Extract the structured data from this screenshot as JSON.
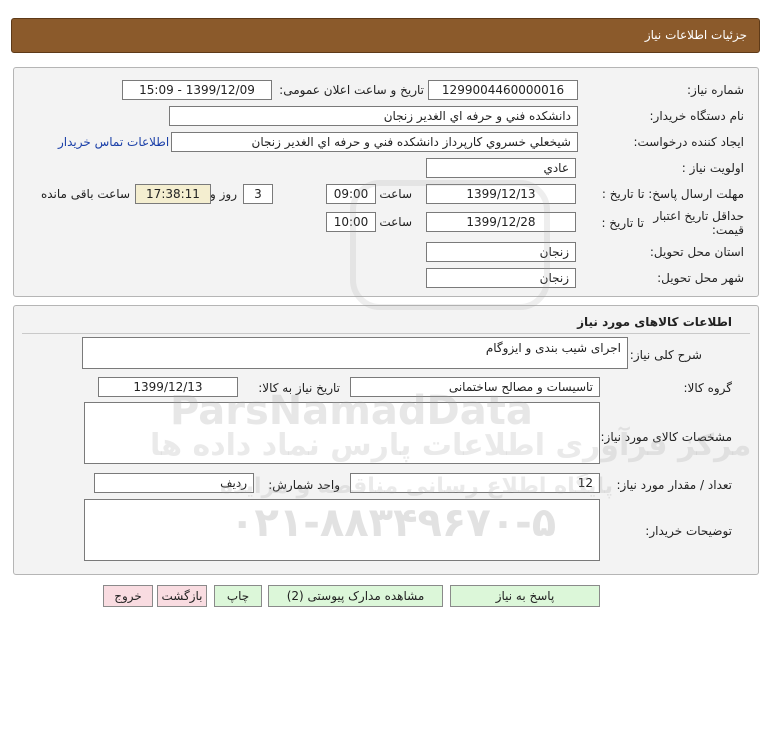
{
  "header": {
    "title": "جزئیات اطلاعات نیاز"
  },
  "info": {
    "need_number_label": "شماره نیاز:",
    "need_number": "1299004460000016",
    "announce_label": "تاریخ و ساعت اعلان عمومی:",
    "announce_value": "1399/12/09 - 15:09",
    "buyer_org_label": "نام دستگاه خریدار:",
    "buyer_org": "دانشکده فني و حرفه اي الغدير زنجان",
    "creator_label": "ایجاد کننده درخواست:",
    "creator": "شیخعلي خسروي کارپرداز دانشکده فني و حرفه اي الغدير زنجان",
    "contact_link": "اطلاعات تماس خریدار",
    "priority_label": "اولویت نیاز :",
    "priority": "عادي",
    "send_deadline_label": "مهلت ارسال پاسخ: تا تاریخ :",
    "send_deadline_date": "1399/12/13",
    "time_label": "ساعت",
    "send_deadline_time": "09:00",
    "days_value": "3",
    "days_label": "روز و",
    "remaining_time": "17:38:11",
    "remaining_label": "ساعت باقی مانده",
    "validity_label": "حداقل تاریخ اعتبار قیمت:",
    "validity_to_label": "تا تاریخ :",
    "validity_date": "1399/12/28",
    "validity_time_label": "ساعت",
    "validity_time": "10:00",
    "province_label": "استان محل تحویل:",
    "province": "زنجان",
    "city_label": "شهر محل تحویل:",
    "city": "زنجان"
  },
  "goods": {
    "section_title": "اطلاعات کالاهای مورد نیاز",
    "desc_label": "شرح کلی نیاز:",
    "desc": "اجرای شیب بندی و ایزوگام",
    "group_label": "گروه کالا:",
    "group": "تاسیسات و مصالح ساختمانی",
    "need_date_label": "تاریخ نیاز به کالا:",
    "need_date": "1399/12/13",
    "specs_label": "مشخصات کالای مورد نیاز:",
    "specs": "",
    "qty_label": "تعداد / مقدار مورد نیاز:",
    "qty": "12",
    "unit_label": "واحد شمارش:",
    "unit": "ردیف",
    "buyer_notes_label": "توضیحات خریدار:",
    "buyer_notes": ""
  },
  "buttons": {
    "reply": "پاسخ به نیاز",
    "attachments": "مشاهده مدارک پیوستی (2)",
    "print": "چاپ",
    "back": "بازگشت",
    "exit": "خروج"
  },
  "watermark": {
    "brand": "ParsNamadData",
    "line1": "مرکز فرآوری اطلاعات پارس نماد داده ها",
    "line2": "پایگاه اطلاع رسانی مناقصه و مزایده",
    "phone": "۰۲۱-۸۸۳۴۹۶۷۰-۵"
  },
  "colors": {
    "header_bg": "#8b5a2b",
    "panel_bg": "#f3f3f3",
    "link": "#1a3fa8",
    "remaining_bg": "#f4eed0",
    "green_button": "#dcf7d9",
    "pink_button": "#f9dce1"
  }
}
